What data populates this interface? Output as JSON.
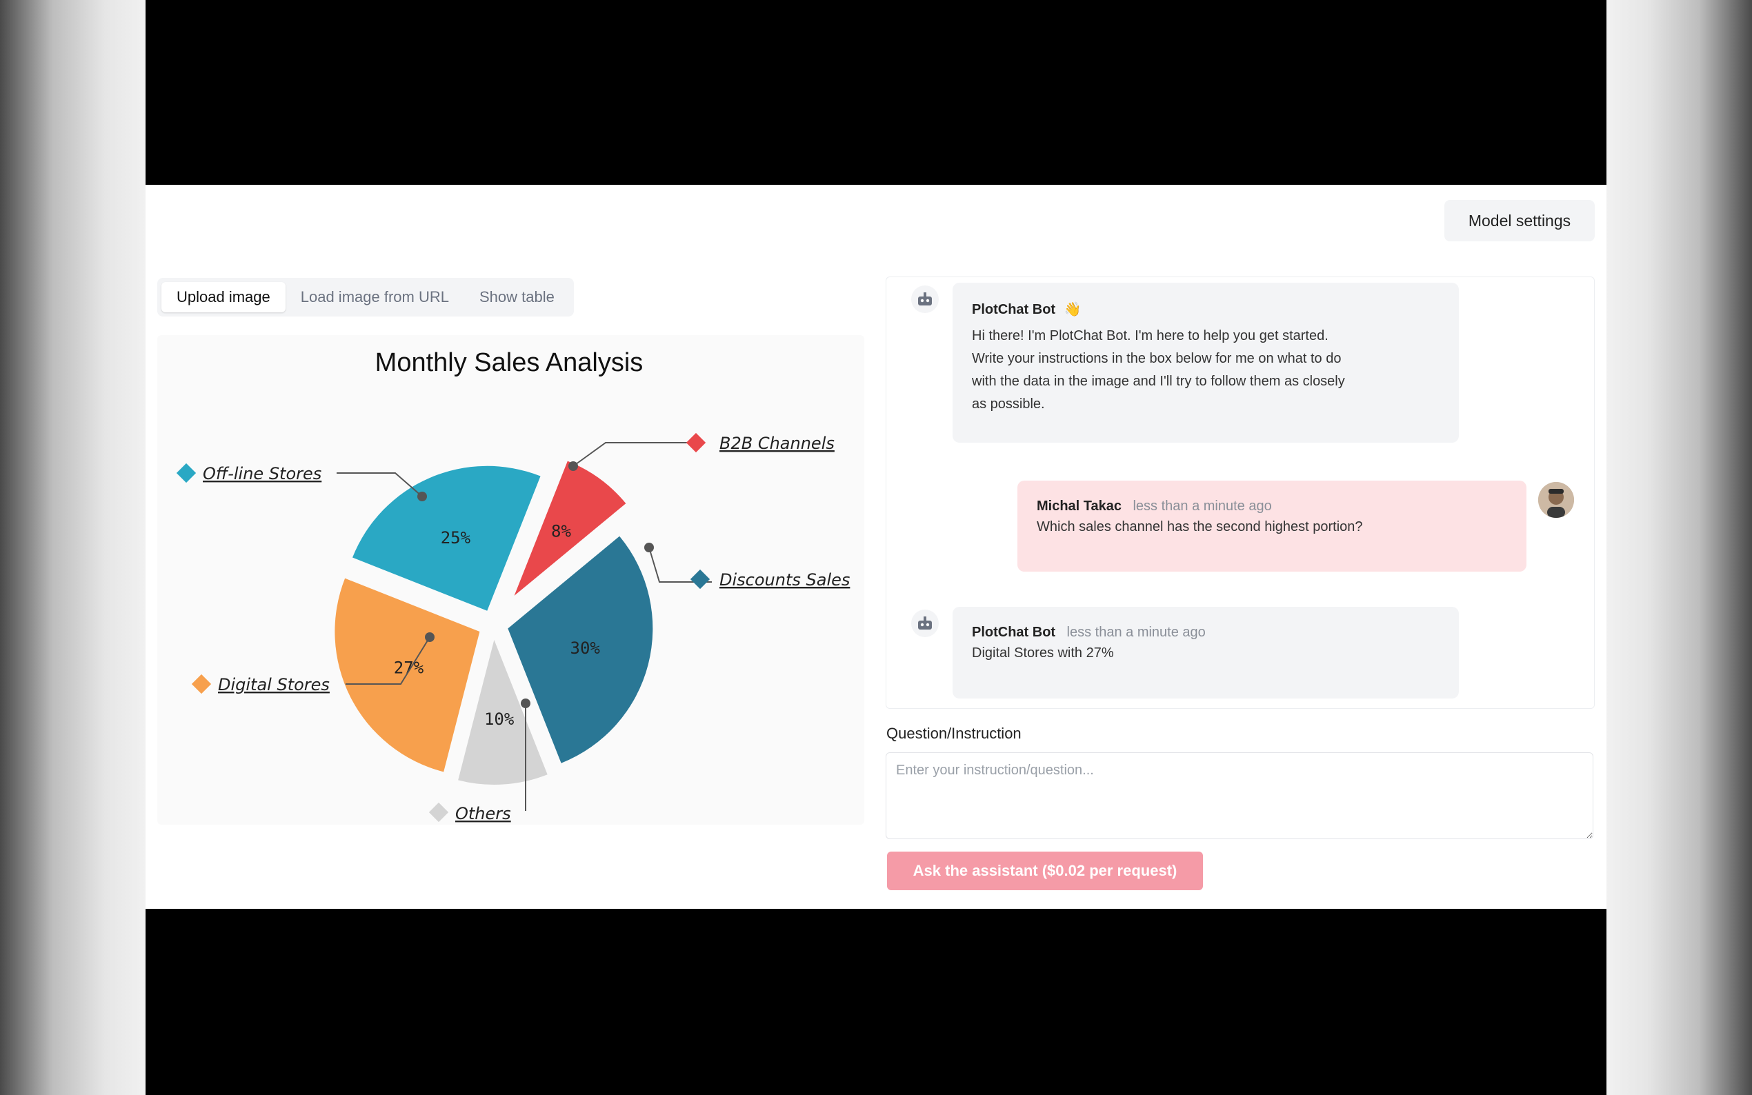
{
  "header": {
    "model_settings_label": "Model settings"
  },
  "tabs": [
    {
      "label": "Upload image",
      "active": true
    },
    {
      "label": "Load image from URL",
      "active": false
    },
    {
      "label": "Show table",
      "active": false
    }
  ],
  "chart_data": {
    "type": "pie",
    "title": "Monthly Sales Analysis",
    "categories": [
      "B2B Channels",
      "Discounts Sales",
      "Others",
      "Digital Stores",
      "Off-line Stores"
    ],
    "values": [
      8,
      30,
      10,
      27,
      25
    ],
    "value_labels": [
      "8%",
      "30%",
      "10%",
      "27%",
      "25%"
    ],
    "colors": [
      "#e9484b",
      "#2a7795",
      "#d4d4d4",
      "#f7a04d",
      "#2aa8c4"
    ],
    "exploded": true,
    "legend": "callouts"
  },
  "chat": {
    "messages": [
      {
        "sender": "PlotChat Bot",
        "emoji": "👋",
        "time": "",
        "lines": [
          "Hi there! I'm PlotChat Bot. I'm here to help you get started.",
          "Write your instructions in the box below for me on what to do",
          "with the data in the image and I'll try to follow them as closely",
          "as possible."
        ]
      },
      {
        "sender": "Michal Takac",
        "time": "less than a minute ago",
        "lines": [
          "Which sales channel has the second highest portion?"
        ]
      },
      {
        "sender": "PlotChat Bot",
        "time": "less than a minute ago",
        "lines": [
          "Digital Stores with 27%"
        ]
      }
    ]
  },
  "form": {
    "question_label": "Question/Instruction",
    "placeholder": "Enter your instruction/question...",
    "ask_button_label": "Ask the assistant ($0.02 per request)"
  },
  "icons": {
    "bot_avatar": "robot-icon",
    "user_avatar": "user-photo"
  }
}
